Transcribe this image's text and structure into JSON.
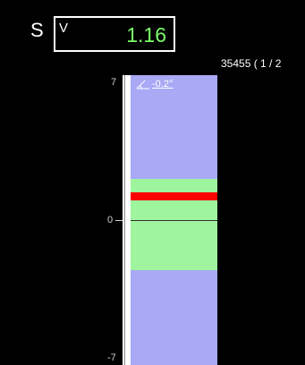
{
  "header": {
    "letter": "S",
    "sub_letter": "V",
    "value": "1.16",
    "value_color": "#7cff6a",
    "id_text": "35455 ( 1 / 2"
  },
  "scale": {
    "top_label": "7",
    "zero_label": "0",
    "bottom_label": "-7",
    "min": -7,
    "max": 7
  },
  "column": {
    "angle_icon": "angle-icon",
    "angle_text": "-0.2°",
    "band_low": -2.5,
    "band_high": 2.1,
    "marker_value": 1.2,
    "band_color": "#9ef59e",
    "column_color": "#a9a9f5",
    "marker_color": "#ff0000"
  }
}
